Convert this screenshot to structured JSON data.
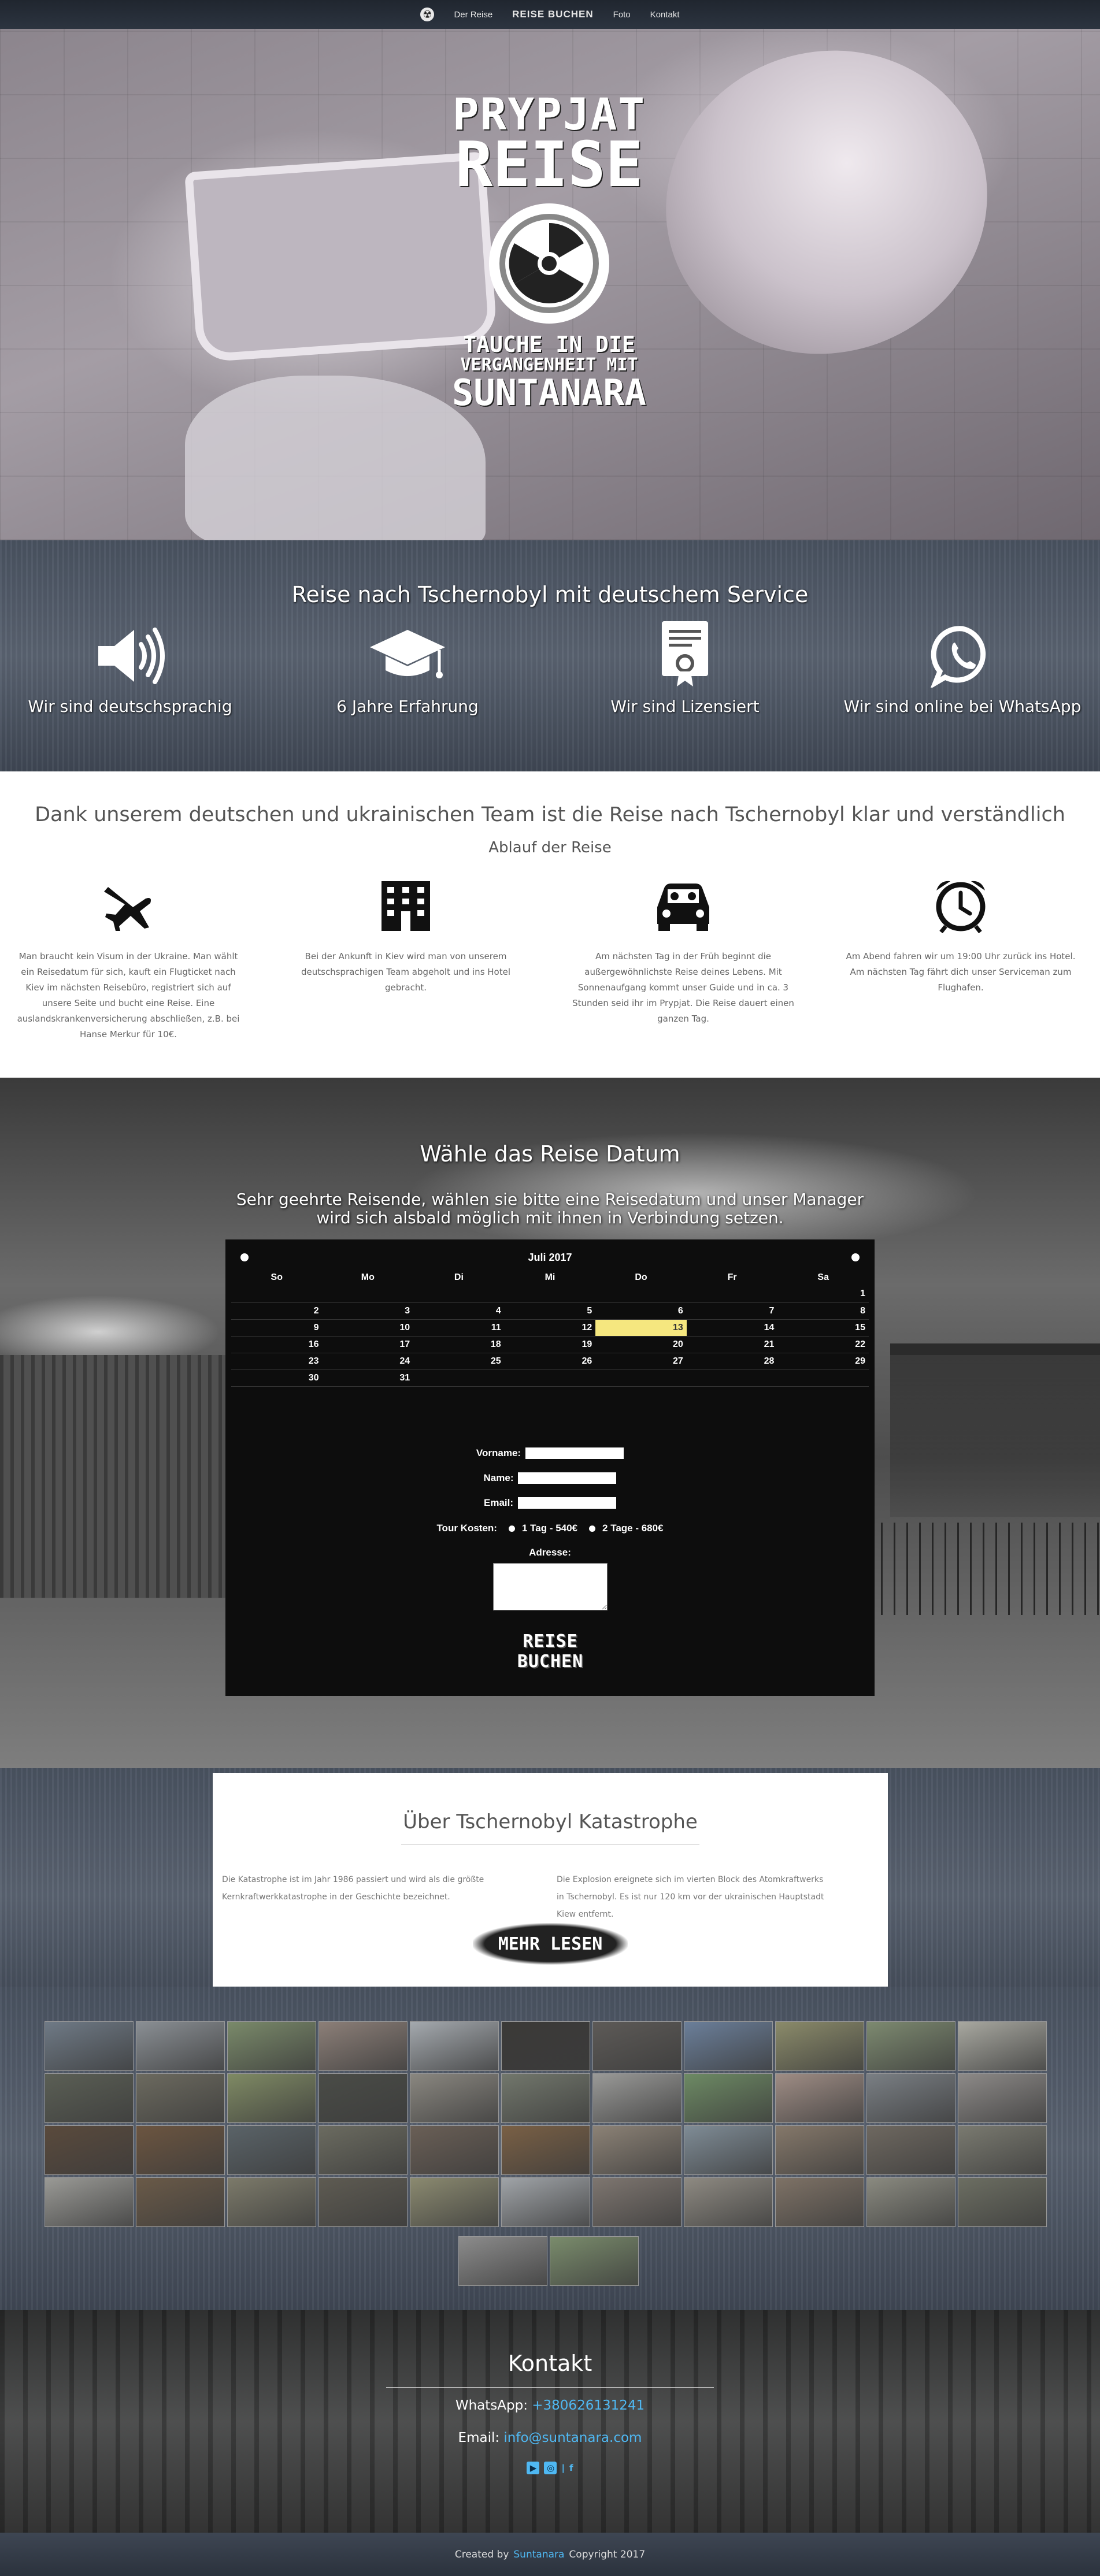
{
  "nav": {
    "items": [
      "Der Reise",
      "REISE BUCHEN",
      "Foto",
      "Kontakt"
    ]
  },
  "hero": {
    "logo_line1": "PRYPJAT",
    "logo_line2": "REISE",
    "tagline1": "TAUCHE IN DIE",
    "tagline2": "VERGANGENHEIT MIT",
    "tagline3": "SUNTANARA"
  },
  "features": {
    "title": "Reise nach Tschernobyl mit deutschem Service",
    "items": [
      {
        "icon": "speaker-icon",
        "label": "Wir sind deutschsprachig"
      },
      {
        "icon": "graduation-cap-icon",
        "label": "6 Jahre Erfahrung"
      },
      {
        "icon": "certificate-icon",
        "label": "Wir sind Lizensiert"
      },
      {
        "icon": "whatsapp-icon",
        "label": "Wir sind online bei WhatsApp"
      }
    ]
  },
  "process": {
    "title": "Dank unserem deutschen und ukrainischen Team ist die Reise nach Tschernobyl klar und verständlich",
    "subtitle": "Ablauf der Reise",
    "steps": [
      {
        "icon": "airplane-icon",
        "text": "Man braucht kein Visum in der Ukraine. Man wählt ein Reisedatum für sich, kauft ein Flugticket nach Kiev im nächsten Reisebüro, registriert sich auf unsere Seite und bucht eine Reise. Eine auslandskrankenversicherung abschließen, z.B. bei Hanse Merkur für 10€."
      },
      {
        "icon": "hotel-icon",
        "text": "Bei der Ankunft in Kiev wird man von unserem deutschsprachigen Team abgeholt und ins Hotel gebracht."
      },
      {
        "icon": "car-icon",
        "text": "Am nächsten Tag in der Früh beginnt die außergewöhnlichste Reise deines Lebens. Mit Sonnenaufgang kommt unser Guide und in ca. 3 Stunden seid ihr im Prypjat. Die Reise dauert einen ganzen Tag."
      },
      {
        "icon": "alarm-clock-icon",
        "text": "Am Abend fahren wir um 19:00 Uhr zurück ins Hotel. Am nächsten Tag fährt dich unser Serviceman zum Flughafen."
      }
    ]
  },
  "booking": {
    "title": "Wähle das Reise Datum",
    "intro": "Sehr geehrte Reisende, wählen sie bitte eine Reisedatum und unser Manager wird sich alsbald möglich mit ihnen in Verbindung setzen.",
    "calendar": {
      "month": "Juli 2017",
      "weekdays": [
        "So",
        "Mo",
        "Di",
        "Mi",
        "Do",
        "Fr",
        "Sa"
      ],
      "weeks": [
        [
          "",
          "",
          "",
          "",
          "",
          "",
          "1"
        ],
        [
          "2",
          "3",
          "4",
          "5",
          "6",
          "7",
          "8"
        ],
        [
          "9",
          "10",
          "11",
          "12",
          "13",
          "14",
          "15"
        ],
        [
          "16",
          "17",
          "18",
          "19",
          "20",
          "21",
          "22"
        ],
        [
          "23",
          "24",
          "25",
          "26",
          "27",
          "28",
          "29"
        ],
        [
          "30",
          "31",
          "",
          "",
          "",
          "",
          ""
        ]
      ],
      "selected": "13"
    },
    "form": {
      "first_name_label": "Vorname:",
      "name_label": "Name:",
      "email_label": "Email:",
      "cost_label": "Tour Kosten:",
      "option1": "1 Tag - 540€",
      "option2": "2 Tage - 680€",
      "address_label": "Adresse:",
      "submit": "REISE BUCHEN"
    }
  },
  "about": {
    "title": "Über Tschernobyl Katastrophe",
    "col1": "Die Katastrophe ist im Jahr 1986 passiert und wird als die größte Kernkraftwerkkatastrophe in der Geschichte bezeichnet.",
    "col2": "Die Explosion ereignete sich im vierten Block des Atomkraftwerks in Tschernobyl. Es ist nur 120 km vor der ukrainischen Hauptstadt Kiew entfernt.",
    "more": "MEHR LESEN"
  },
  "gallery": {
    "colors": [
      "#6f7a86",
      "#8a8f94",
      "#7a8a6a",
      "#8c7f78",
      "#a4a9ae",
      "#3b3a38",
      "#5d5a57",
      "#6b7f9a",
      "#8b8b6a",
      "#7d8a70",
      "#a8a8a0",
      "#5b5f55",
      "#6c6a5f",
      "#7f8a64",
      "#4a4c47",
      "#8a8780",
      "#72776c",
      "#9a9a98",
      "#6d8a64",
      "#9f8d85",
      "#7a7f84",
      "#8d8a88",
      "#5a4a3c",
      "#6c5540",
      "#5a6368",
      "#6b6b60",
      "#6a5f56",
      "#7a6045",
      "#8c8276",
      "#7f8c96",
      "#85786a",
      "#6e6860",
      "#7a7a70",
      "#9a9a96",
      "#6a5a48",
      "#7c7a6a",
      "#5e5b52",
      "#8b8a70",
      "#a0a4a8",
      "#7e7670",
      "#8e8a82",
      "#7e7266",
      "#8a8a80",
      "#6c6e62",
      "#8c8c8c",
      "#7a8c6c"
    ]
  },
  "contact": {
    "title": "Kontakt",
    "whatsapp_label": "WhatsApp:",
    "whatsapp_value": "+380626131241",
    "email_label": "Email:",
    "email_value": "info@suntanara.com"
  },
  "footer": {
    "created_by": "Created by",
    "author": "Suntanara",
    "copyright": "Copyright 2017"
  }
}
